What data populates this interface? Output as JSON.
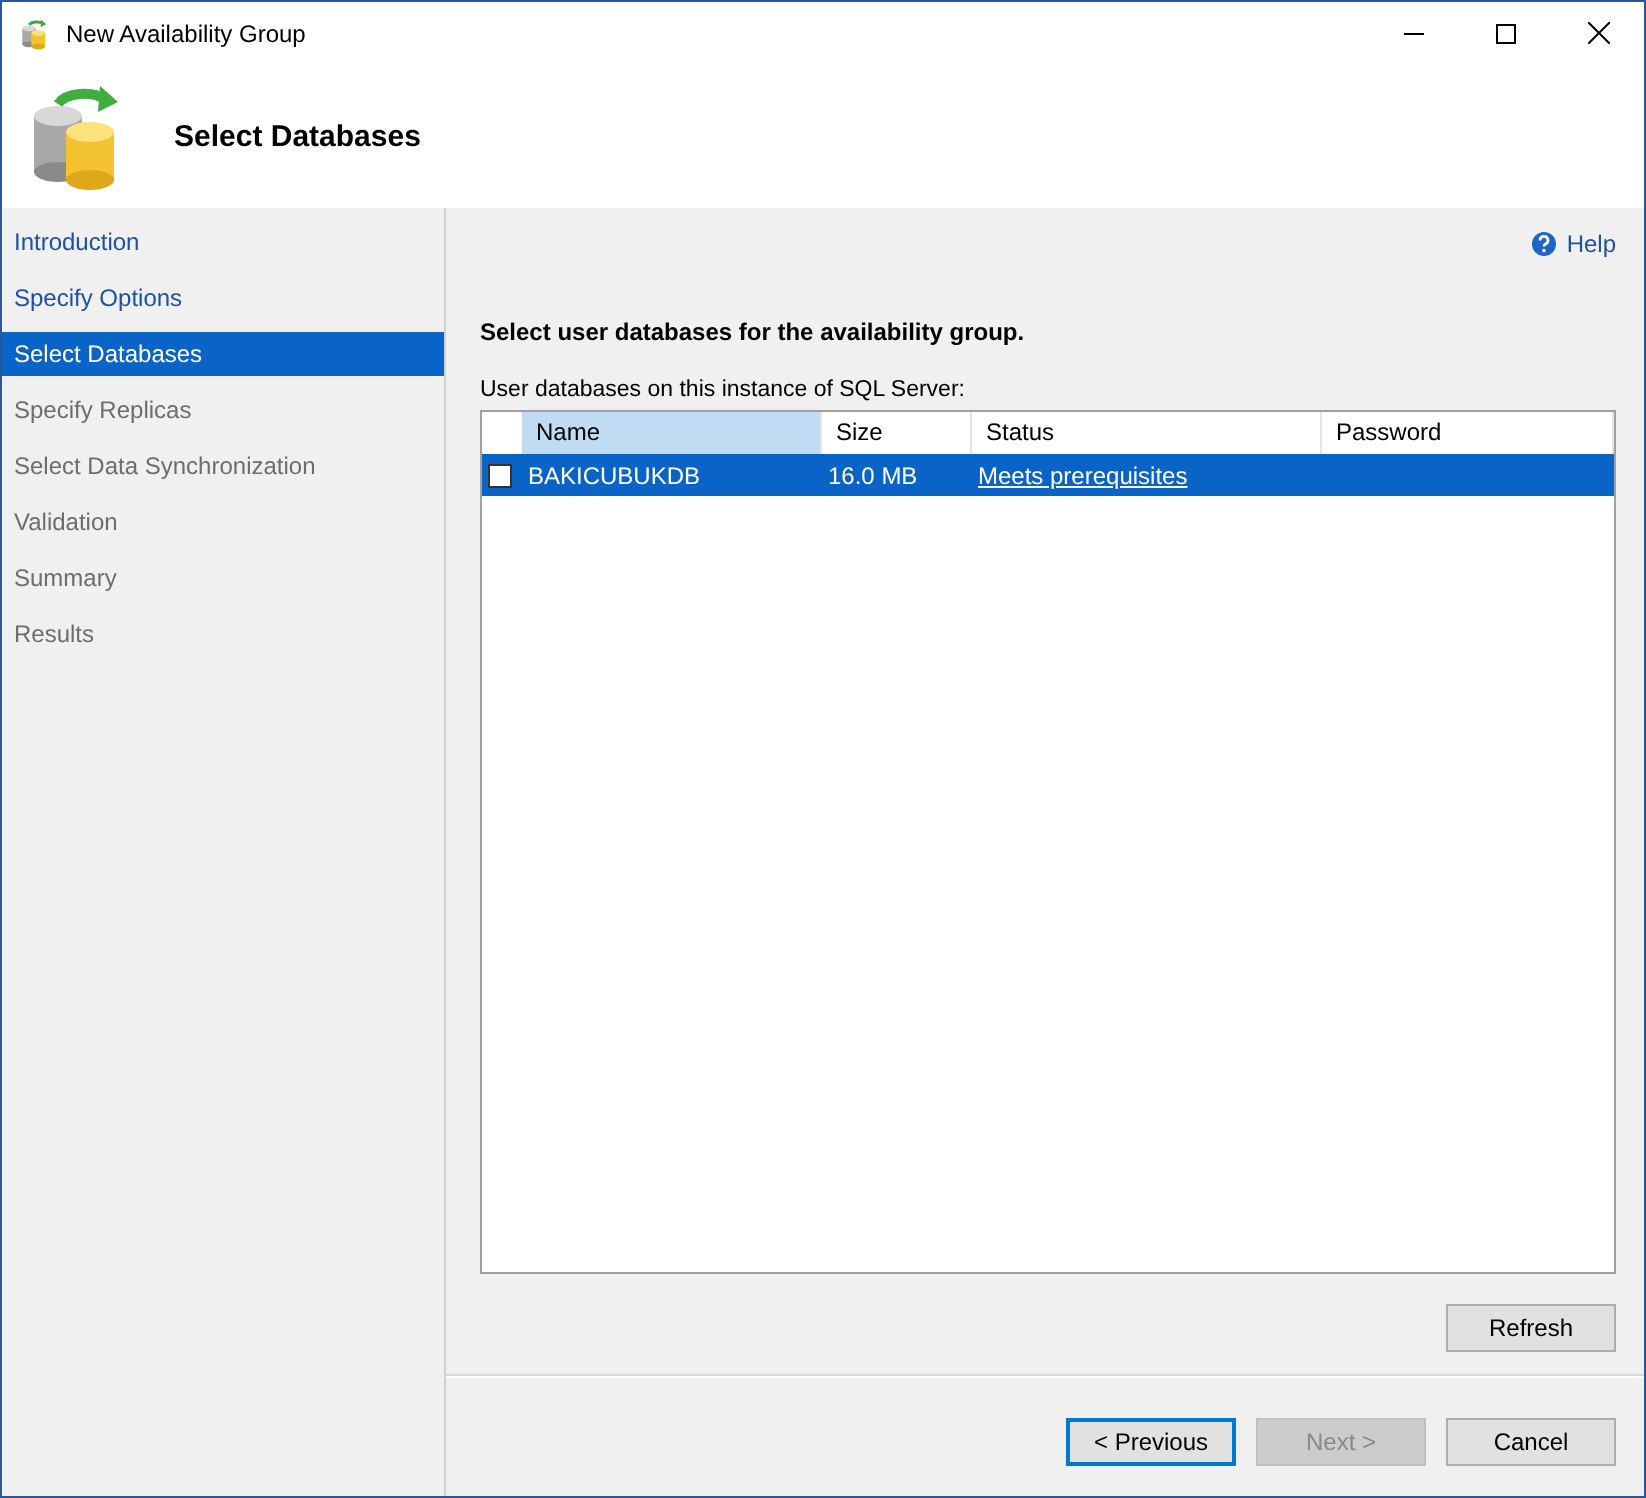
{
  "window": {
    "title": "New Availability Group"
  },
  "header": {
    "title": "Select Databases"
  },
  "sidebar": {
    "items": [
      {
        "label": "Introduction",
        "completed": true,
        "selected": false
      },
      {
        "label": "Specify Options",
        "completed": true,
        "selected": false
      },
      {
        "label": "Select Databases",
        "completed": true,
        "selected": true
      },
      {
        "label": "Specify Replicas",
        "completed": false,
        "selected": false
      },
      {
        "label": "Select Data Synchronization",
        "completed": false,
        "selected": false
      },
      {
        "label": "Validation",
        "completed": false,
        "selected": false
      },
      {
        "label": "Summary",
        "completed": false,
        "selected": false
      },
      {
        "label": "Results",
        "completed": false,
        "selected": false
      }
    ]
  },
  "help": "Help",
  "heading": "Select user databases for the availability group.",
  "table_label": "User databases on this instance of SQL Server:",
  "table": {
    "columns": [
      {
        "label": "Name",
        "sorted": true
      },
      {
        "label": "Size",
        "sorted": false
      },
      {
        "label": "Status",
        "sorted": false
      },
      {
        "label": "Password",
        "sorted": false
      }
    ],
    "rows": [
      {
        "checked": false,
        "selected": true,
        "name": "BAKICUBUKDB",
        "size": "16.0 MB",
        "status": "Meets prerequisites"
      }
    ]
  },
  "refresh": "Refresh",
  "buttons": [
    {
      "label": "< Previous",
      "focused": true,
      "disabled": false
    },
    {
      "label": "Next >",
      "focused": false,
      "disabled": true
    },
    {
      "label": "Cancel",
      "focused": false,
      "disabled": false
    }
  ]
}
